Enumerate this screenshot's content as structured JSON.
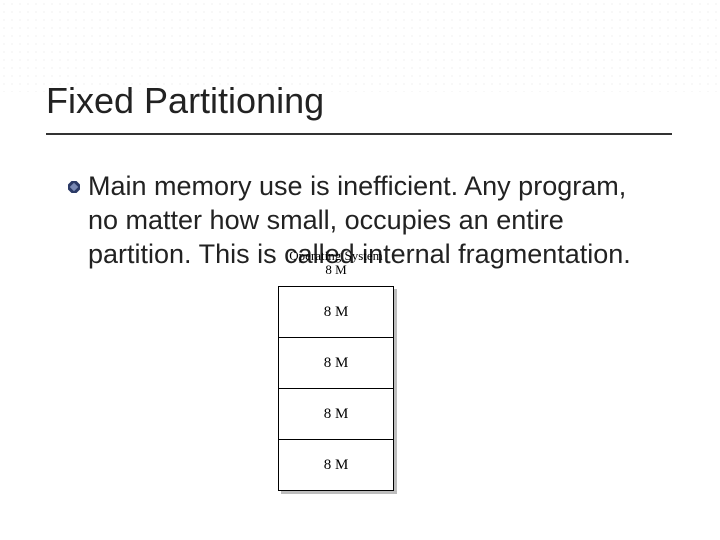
{
  "title": "Fixed Partitioning",
  "bullet": "Main memory use is inefficient.  Any program, no matter how small, occupies an entire partition.  This is called internal fragmentation.",
  "os_label": "Operating System",
  "os_size": "8 M",
  "partitions": {
    "p0": "8 M",
    "p1": "8 M",
    "p2": "8 M",
    "p3": "8 M"
  }
}
